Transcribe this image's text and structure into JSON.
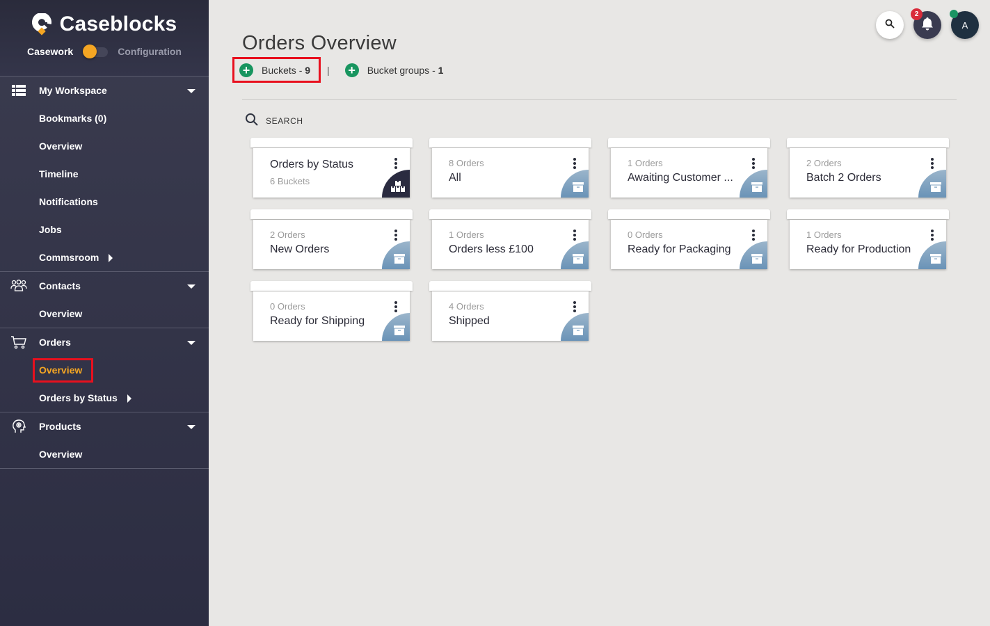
{
  "app": {
    "brand_name": "Caseblocks",
    "mode_left": "Casework",
    "mode_right": "Configuration",
    "accent_color": "#f5a623"
  },
  "sidebar": {
    "groups": [
      {
        "label": "My Workspace",
        "icon": "list-icon",
        "items": [
          {
            "label": "Bookmarks (0)"
          },
          {
            "label": "Overview"
          },
          {
            "label": "Timeline"
          },
          {
            "label": "Notifications"
          },
          {
            "label": "Jobs"
          },
          {
            "label": "Commsroom",
            "has_submenu": true
          }
        ]
      },
      {
        "label": "Contacts",
        "icon": "people-icon",
        "items": [
          {
            "label": "Overview"
          }
        ]
      },
      {
        "label": "Orders",
        "icon": "cart-icon",
        "items": [
          {
            "label": "Overview",
            "active": true
          },
          {
            "label": "Orders by Status",
            "has_submenu": true
          }
        ]
      },
      {
        "label": "Products",
        "icon": "head-gear-icon",
        "items": [
          {
            "label": "Overview"
          }
        ]
      }
    ]
  },
  "topbar": {
    "notification_count": "2",
    "avatar_initial": "A"
  },
  "main": {
    "title": "Orders Overview",
    "buckets_label": "Buckets - ",
    "buckets_count": "9",
    "separator": "|",
    "bucket_groups_label": "Bucket groups - ",
    "bucket_groups_count": "1",
    "search_label": "SEARCH",
    "cards": [
      {
        "type": "group",
        "title": "Orders by Status",
        "subtitle": "6 Buckets"
      },
      {
        "type": "bucket",
        "title": "All",
        "subtitle": "8 Orders"
      },
      {
        "type": "bucket",
        "title": "Awaiting Customer ...",
        "subtitle": "1 Orders"
      },
      {
        "type": "bucket",
        "title": "Batch 2 Orders",
        "subtitle": "2 Orders"
      },
      {
        "type": "bucket",
        "title": "New Orders",
        "subtitle": "2 Orders"
      },
      {
        "type": "bucket",
        "title": "Orders less £100",
        "subtitle": "1 Orders"
      },
      {
        "type": "bucket",
        "title": "Ready for Packaging",
        "subtitle": "0 Orders"
      },
      {
        "type": "bucket",
        "title": "Ready for Production",
        "subtitle": "1 Orders"
      },
      {
        "type": "bucket",
        "title": "Ready for Shipping",
        "subtitle": "0 Orders"
      },
      {
        "type": "bucket",
        "title": "Shipped",
        "subtitle": "4 Orders"
      }
    ]
  }
}
